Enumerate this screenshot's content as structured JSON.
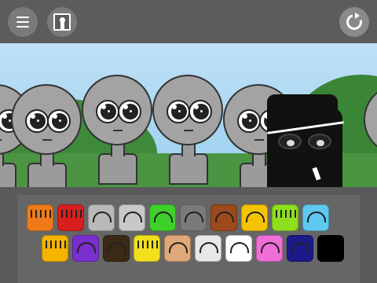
{
  "toolbar": {
    "menu_icon": "hamburger-icon",
    "picture_icon": "portrait-frame-icon",
    "reset_icon": "reset-icon"
  },
  "stage": {
    "background": "sky-and-grass",
    "characters": [
      {
        "kind": "gray",
        "color": "#a3a3a3"
      },
      {
        "kind": "gray",
        "color": "#a3a3a3"
      },
      {
        "kind": "gray",
        "color": "#a3a3a3"
      },
      {
        "kind": "gray",
        "color": "#a3a3a3"
      },
      {
        "kind": "gray",
        "color": "#a3a3a3"
      },
      {
        "kind": "black-hat",
        "color": "#111111"
      },
      {
        "kind": "gray",
        "color": "#a3a3a3"
      }
    ]
  },
  "palette": {
    "row1": [
      {
        "icon": "orange-crown-icon",
        "color": "#f07a1a"
      },
      {
        "icon": "red-spiky-hair-icon",
        "color": "#d81e1e"
      },
      {
        "icon": "silver-hat-icon",
        "color": "#b9b9b9"
      },
      {
        "icon": "headphones-icon",
        "color": "#c8c8c8"
      },
      {
        "icon": "green-blob-icon",
        "color": "#3ecf2a"
      },
      {
        "icon": "gray-horns-icon",
        "color": "#7a7a7a"
      },
      {
        "icon": "brown-block-icon",
        "color": "#9c4a1c"
      },
      {
        "icon": "yellow-cap-icon",
        "color": "#f5c400"
      },
      {
        "icon": "lime-spikes-icon",
        "color": "#8fe01c"
      },
      {
        "icon": "blue-cloud-icon",
        "color": "#5ec8ee"
      }
    ],
    "row2": [
      {
        "icon": "gold-crown-icon",
        "color": "#f5b400"
      },
      {
        "icon": "purple-horns-icon",
        "color": "#7a2ed0"
      },
      {
        "icon": "dark-leaf-icon",
        "color": "#3a2a14"
      },
      {
        "icon": "yellow-electric-icon",
        "color": "#f2e01c"
      },
      {
        "icon": "tan-hair-icon",
        "color": "#e0a878"
      },
      {
        "icon": "propeller-cap-icon",
        "color": "#e8e8e8"
      },
      {
        "icon": "white-cat-ears-icon",
        "color": "#ffffff"
      },
      {
        "icon": "pink-bunny-ears-icon",
        "color": "#f06ed8"
      },
      {
        "icon": "navy-helmet-icon",
        "color": "#1a1a8a"
      },
      {
        "icon": "black-slot-icon",
        "color": "#000000"
      }
    ]
  }
}
